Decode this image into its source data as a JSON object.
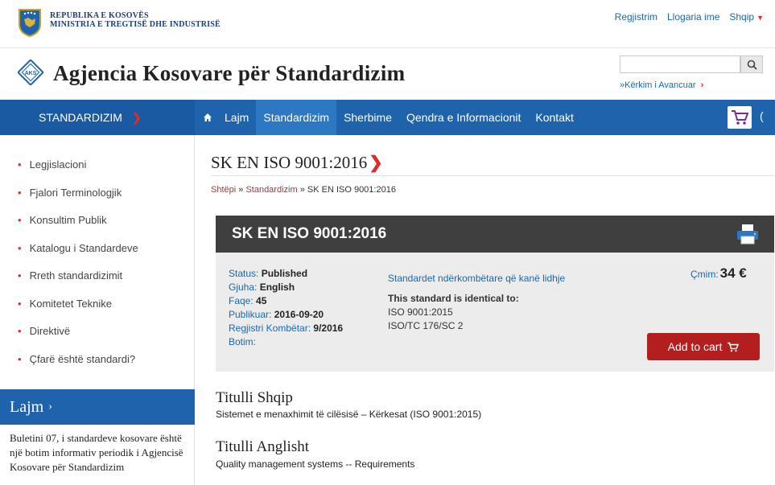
{
  "topbar": {
    "ministry_line1": "REPUBLIKA E KOSOVËS",
    "ministry_line2": "MINISTRIA E TREGTISË DHE INDUSTRISË",
    "register": "Regjistrim",
    "account": "Llogaria ime",
    "language": "Shqip"
  },
  "header": {
    "title": "Agjencia Kosovare për Standardizim",
    "search_placeholder": "",
    "advanced_search": "»Kërkim i Avancuar"
  },
  "nav": {
    "category": "STANDARDIZIM",
    "items": [
      "Lajm",
      "Standardizim",
      "Sherbime",
      "Qendra e Informacionit",
      "Kontakt"
    ],
    "active": "Standardizim",
    "overflow": "("
  },
  "sidebar": {
    "items": [
      "Legjislacioni",
      "Fjalori Terminologjik",
      "Konsultim Publik",
      "Katalogu i Standardeve",
      "Rreth standardizimit",
      "Komitetet Teknike",
      "Direktivë",
      "Çfarë është standardi?"
    ],
    "news_title": "Lajm",
    "news_text": "Buletini 07, i standardeve kosovare është një botim informativ periodik i Agjencisë Kosovare për Standardizim"
  },
  "page": {
    "title": "SK EN ISO 9001:2016",
    "breadcrumb": [
      "Shtëpi",
      "Standardizim",
      "SK EN ISO 9001:2016"
    ],
    "breadcrumb_sep": " » "
  },
  "standard": {
    "code": "SK EN ISO 9001:2016",
    "status_label": "Status:",
    "status": "Published",
    "language_label": "Gjuha:",
    "language": "English",
    "pages_label": "Faqe:",
    "pages": "45",
    "published_label": "Publikuar:",
    "published": "2016-09-20",
    "registry_label": "Regjistri Kombëtar:",
    "registry": "9/2016",
    "edition_label": "Botim:",
    "edition": "",
    "related_link": "Standardet ndërkombëtare që kanë lidhje",
    "identical_label": "This standard is identical to:",
    "identical": [
      "ISO 9001:2015",
      "ISO/TC 176/SC 2"
    ],
    "price_label": "Çmim:",
    "price": "34 €",
    "add_to_cart": "Add to cart"
  },
  "titles": {
    "albanian_heading": "Titulli Shqip",
    "albanian": "Sistemet e menaxhimit të cilësisë – Kërkesat (ISO 9001:2015)",
    "english_heading": "Titulli Anglisht",
    "english": "Quality management systems -- Requirements"
  },
  "colors": {
    "nav_blue": "#1f63ad",
    "accent_red": "#e12a2a",
    "link_blue": "#1768b4",
    "cart_red": "#b31e1e"
  }
}
